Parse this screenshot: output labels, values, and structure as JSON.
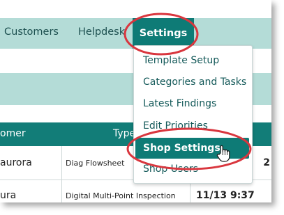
{
  "nav": {
    "customers": "Customers",
    "helpdesk": "Helpdesk",
    "settings": "Settings"
  },
  "table": {
    "headers": [
      "omer",
      "Type"
    ],
    "rows": [
      {
        "customer": "aurora",
        "type": "Diag Flowsheet",
        "time": "2"
      },
      {
        "customer": "ura",
        "type": "Digital Multi-Point Inspection",
        "time": "11/13 9:37"
      }
    ]
  },
  "settings_menu": {
    "items": [
      {
        "label": "Template Setup"
      },
      {
        "label": "Categories and Tasks"
      },
      {
        "label": "Latest Findings"
      },
      {
        "label": "Edit Priorities"
      },
      {
        "label": "Shop Settings"
      },
      {
        "label": "Shop Users"
      }
    ],
    "selected": "Shop Settings"
  },
  "colors": {
    "teal_dark": "#0e7b76",
    "teal_light": "#b4dcd7",
    "annotation_red": "#d9363e"
  },
  "icons": {
    "cursor": "hand-pointer-icon"
  }
}
